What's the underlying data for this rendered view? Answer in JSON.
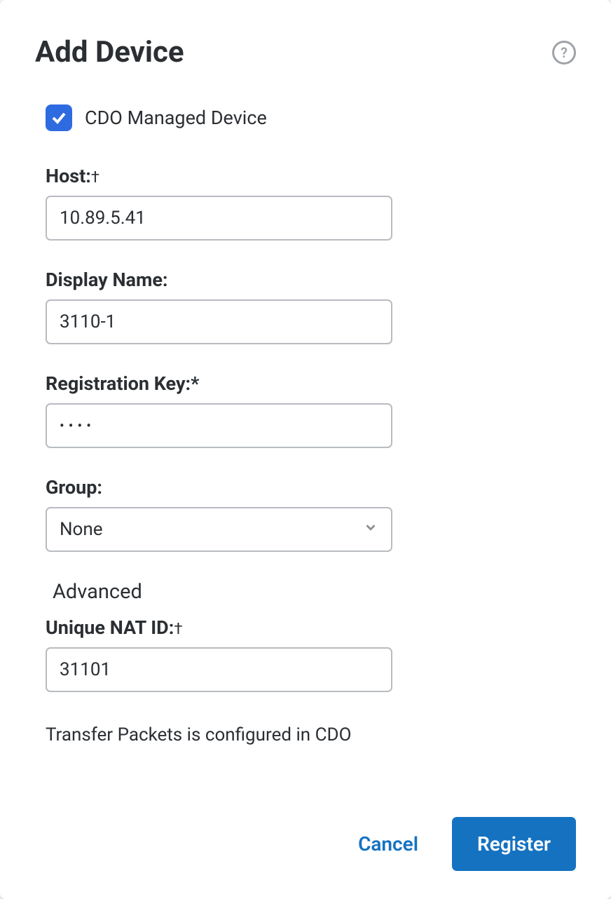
{
  "dialog": {
    "title": "Add Device",
    "cdo_managed": {
      "label": "CDO Managed Device",
      "checked": true
    },
    "fields": {
      "host": {
        "label": "Host:",
        "suffix": "†",
        "value": "10.89.5.41"
      },
      "display_name": {
        "label": "Display Name:",
        "value": "3110-1"
      },
      "registration_key": {
        "label": "Registration Key:*",
        "value": "••••"
      },
      "group": {
        "label": "Group:",
        "value": "None"
      },
      "advanced_header": "Advanced",
      "unique_nat_id": {
        "label": "Unique NAT ID:",
        "suffix": "†",
        "value": "31101"
      }
    },
    "footer_note": "Transfer Packets is configured in CDO",
    "buttons": {
      "cancel": "Cancel",
      "register": "Register"
    }
  }
}
